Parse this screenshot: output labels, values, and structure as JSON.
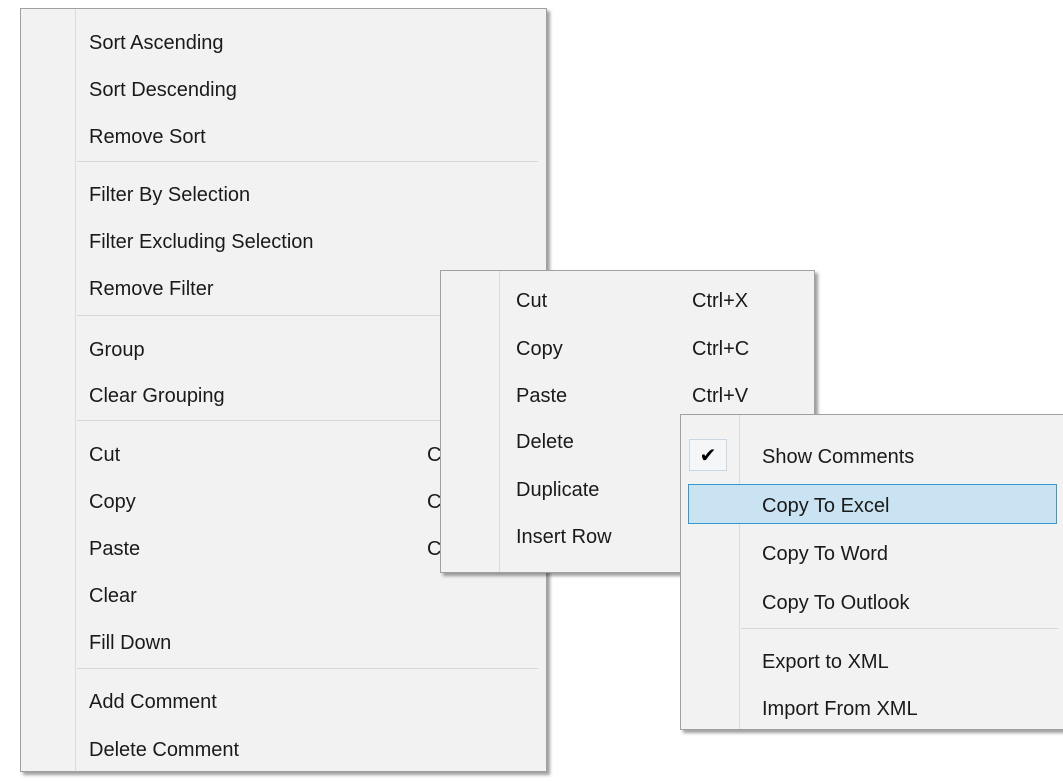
{
  "main_menu": {
    "sort_ascending": "Sort Ascending",
    "sort_descending": "Sort Descending",
    "remove_sort": "Remove Sort",
    "filter_by_selection": "Filter By Selection",
    "filter_excluding_selection": "Filter Excluding Selection",
    "remove_filter": "Remove Filter",
    "group": "Group",
    "clear_grouping": "Clear Grouping",
    "cut": "Cut",
    "cut_shortcut": "C",
    "copy": "Copy",
    "copy_shortcut": "C",
    "paste": "Paste",
    "paste_shortcut": "C",
    "clear": "Clear",
    "fill_down": "Fill Down",
    "add_comment": "Add Comment",
    "delete_comment": "Delete Comment"
  },
  "edit_menu": {
    "cut": "Cut",
    "cut_shortcut": "Ctrl+X",
    "copy": "Copy",
    "copy_shortcut": "Ctrl+C",
    "paste": "Paste",
    "paste_shortcut": "Ctrl+V",
    "delete": "Delete",
    "duplicate": "Duplicate",
    "insert_row": "Insert Row"
  },
  "export_menu": {
    "show_comments": "Show Comments",
    "show_comments_checked": true,
    "check_glyph": "✔",
    "copy_to_excel": "Copy To Excel",
    "copy_to_word": "Copy To Word",
    "copy_to_outlook": "Copy To Outlook",
    "export_to_xml": "Export to XML",
    "import_from_xml": "Import From XML",
    "highlight_color": "#c9e3f2",
    "highlight_border": "#3399cc"
  }
}
